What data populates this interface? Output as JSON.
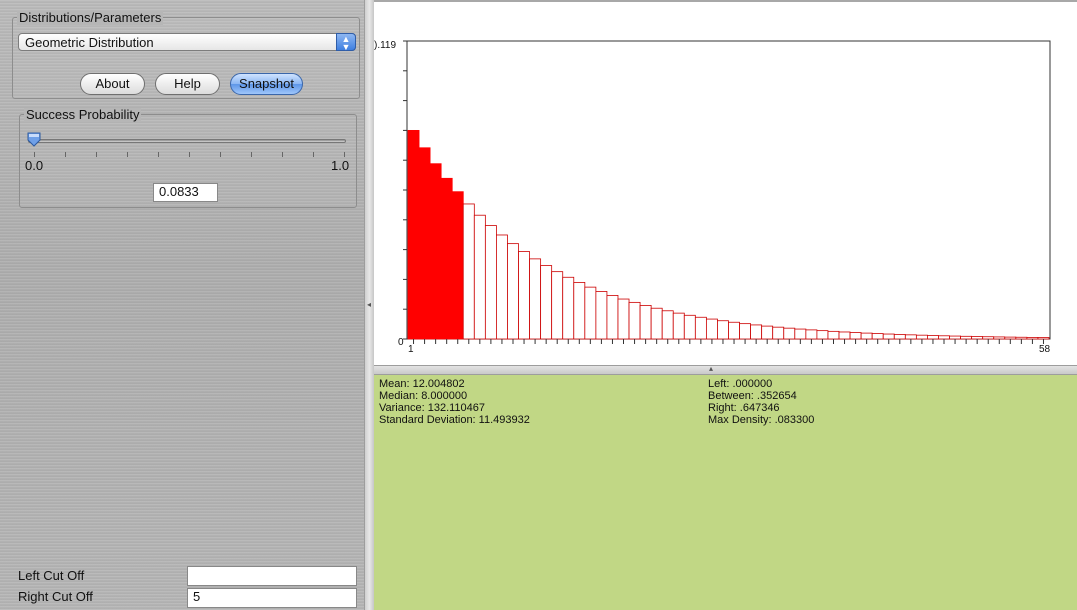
{
  "panel": {
    "title": "Distributions/Parameters",
    "distribution": "Geometric Distribution",
    "buttons": {
      "about": "About",
      "help": "Help",
      "snapshot": "Snapshot"
    }
  },
  "parameter": {
    "title": "Success Probability",
    "min_label": "0.0",
    "max_label": "1.0",
    "value": "0.0833",
    "slider_fraction": 0.0833
  },
  "cutoffs": {
    "left_label": "Left Cut Off",
    "left_value": "",
    "right_label": "Right Cut Off",
    "right_value": "5"
  },
  "chart_data": {
    "type": "bar",
    "y_top_label": ").119",
    "y_zero_label": "0",
    "x_start_label": "1",
    "x_end_label": "58",
    "ylim": [
      0,
      0.119
    ],
    "p": 0.0833,
    "x_start": 1,
    "x_end": 58,
    "highlight_through": 5,
    "highlight_color": "#ff0000",
    "outline_color": "#cc0000"
  },
  "stats": {
    "mean": "Mean: 12.004802",
    "median": "Median: 8.000000",
    "variance": "Variance: 132.110467",
    "sd": "Standard Deviation: 11.493932",
    "left": "Left: .000000",
    "between": "Between: .352654",
    "right": "Right: .647346",
    "max_density": "Max Density: .083300"
  }
}
